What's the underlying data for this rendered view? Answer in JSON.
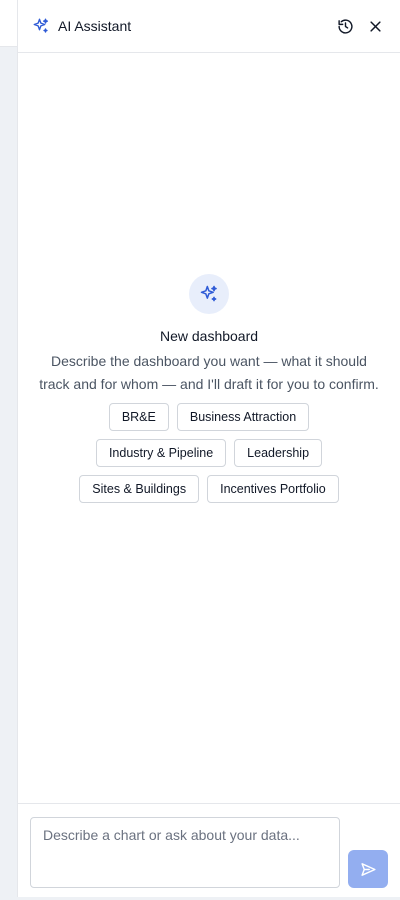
{
  "header": {
    "title": "AI Assistant",
    "icons": [
      "sparkle-icon",
      "history-icon",
      "close-icon"
    ]
  },
  "empty_state": {
    "icon": "sparkle-icon",
    "title": "New dashboard",
    "description": "Describe the dashboard you want — what it should track and for whom — and I'll draft it for you to confirm."
  },
  "suggestions": {
    "rows": [
      [
        "BR&E",
        "Business Attraction"
      ],
      [
        "Industry & Pipeline",
        "Leadership"
      ],
      [
        "Sites & Buildings",
        "Incentives Portfolio"
      ]
    ]
  },
  "composer": {
    "placeholder": "Describe a chart or ask about your data...",
    "value": "",
    "send_icon": "send-icon"
  },
  "colors": {
    "accent": "#2f5bd6",
    "send_button": "#93aef0",
    "icon_circle_bg": "#e8eefb",
    "border": "#d1d5db"
  }
}
